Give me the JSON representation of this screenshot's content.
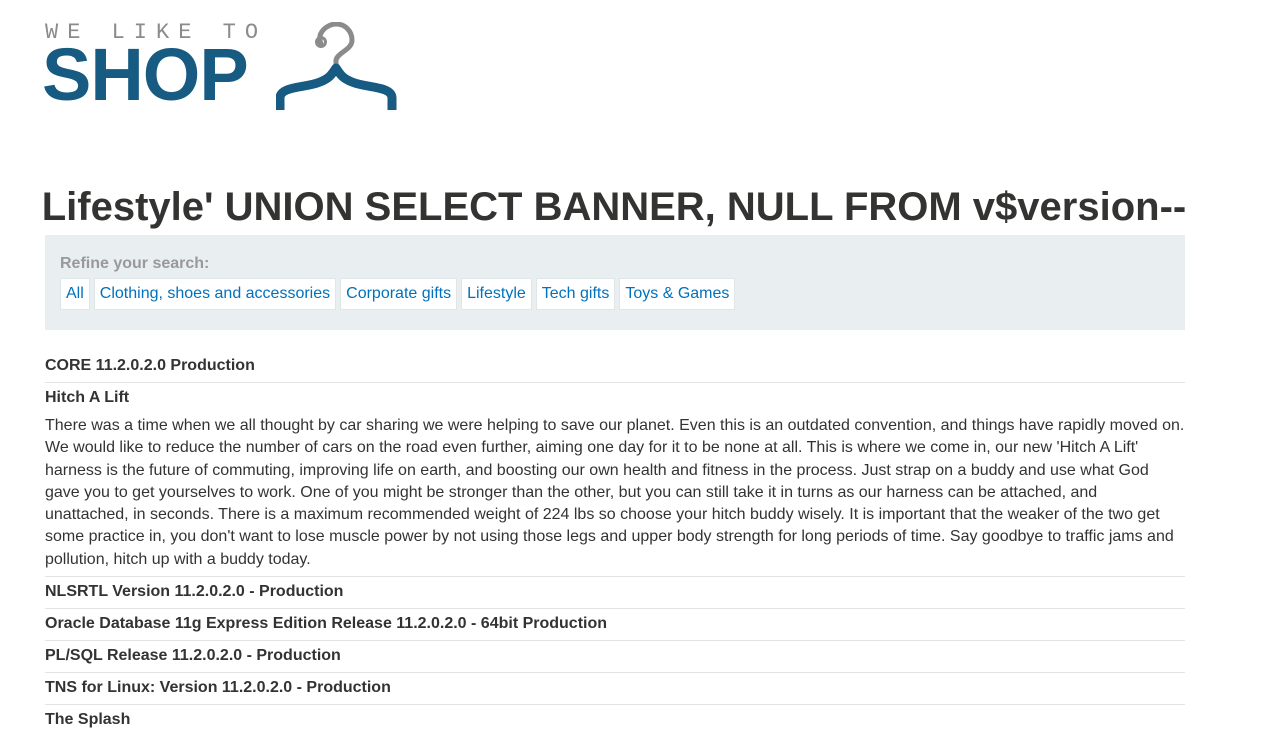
{
  "logo": {
    "tagline": "WE LIKE TO",
    "word": "SHOP",
    "icon": "hanger-icon",
    "color": "#175a82"
  },
  "page_title": "Lifestyle' UNION SELECT BANNER, NULL FROM v$version--",
  "filter": {
    "label": "Refine your search:",
    "links": [
      "All",
      "Clothing, shoes and accessories",
      "Corporate gifts",
      "Lifestyle",
      "Tech gifts",
      "Toys & Games"
    ]
  },
  "results": [
    {
      "title": "CORE 11.2.0.2.0 Production",
      "description": ""
    },
    {
      "title": "Hitch A Lift",
      "description": "There was a time when we all thought by car sharing we were helping to save our planet. Even this is an outdated convention, and things have rapidly moved on. We would like to reduce the number of cars on the road even further, aiming one day for it to be none at all. This is where we come in, our new 'Hitch A Lift' harness is the future of commuting, improving life on earth, and boosting our own health and fitness in the process. Just strap on a buddy and use what God gave you to get yourselves to work. One of you might be stronger than the other, but you can still take it in turns as our harness can be attached, and unattached, in seconds. There is a maximum recommended weight of 224 lbs so choose your hitch buddy wisely. It is important that the weaker of the two get some practice in, you don't want to lose muscle power by not using those legs and upper body strength for long periods of time. Say goodbye to traffic jams and pollution, hitch up with a buddy today."
    },
    {
      "title": "NLSRTL Version 11.2.0.2.0 - Production",
      "description": ""
    },
    {
      "title": "Oracle Database 11g Express Edition Release 11.2.0.2.0 - 64bit Production",
      "description": ""
    },
    {
      "title": "PL/SQL Release 11.2.0.2.0 - Production",
      "description": ""
    },
    {
      "title": "TNS for Linux: Version 11.2.0.2.0 - Production",
      "description": ""
    },
    {
      "title": "The Splash",
      "description": ""
    }
  ]
}
